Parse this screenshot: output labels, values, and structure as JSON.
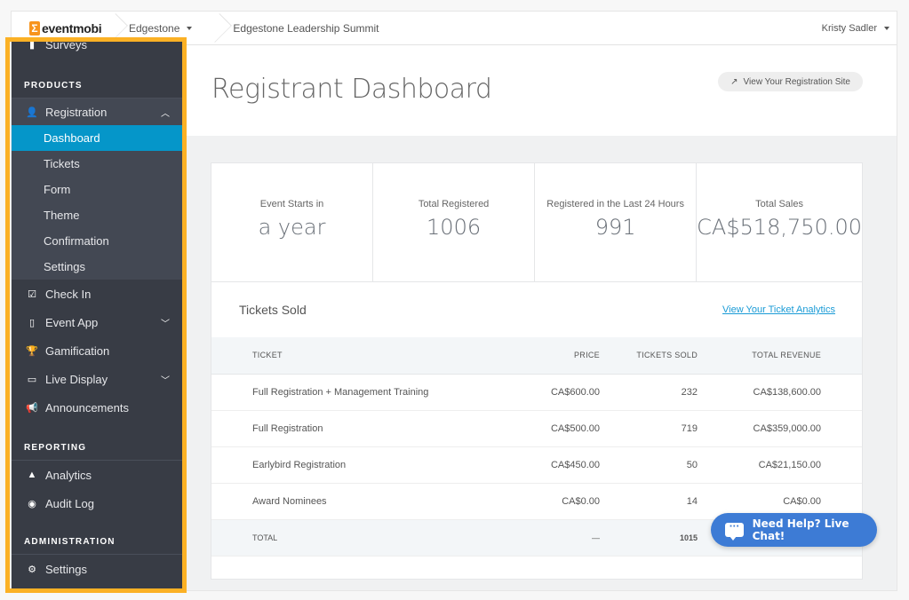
{
  "topbar": {
    "logo_text": "eventmobi",
    "org_crumb": "Edgestone",
    "event_crumb": "Edgestone Leadership Summit",
    "user_name": "Kristy Sadler"
  },
  "sidebar": {
    "top_item": {
      "label": "Surveys",
      "icon": "surveys-icon"
    },
    "sections": [
      {
        "title": "PRODUCTS"
      },
      {
        "title": "REPORTING"
      },
      {
        "title": "ADMINISTRATION"
      }
    ],
    "registration": {
      "label": "Registration",
      "expanded": true,
      "children": [
        "Dashboard",
        "Tickets",
        "Form",
        "Theme",
        "Confirmation",
        "Settings"
      ],
      "active": "Dashboard"
    },
    "products_items": [
      {
        "label": "Check In",
        "icon": "check-in-icon"
      },
      {
        "label": "Event App",
        "icon": "event-app-icon",
        "has_chevron": true
      },
      {
        "label": "Gamification",
        "icon": "trophy-icon"
      },
      {
        "label": "Live Display",
        "icon": "live-display-icon",
        "has_chevron": true
      },
      {
        "label": "Announcements",
        "icon": "megaphone-icon"
      }
    ],
    "reporting_items": [
      {
        "label": "Analytics",
        "icon": "analytics-icon"
      },
      {
        "label": "Audit Log",
        "icon": "audit-log-icon"
      }
    ],
    "administration_items": [
      {
        "label": "Settings",
        "icon": "gear-icon"
      }
    ]
  },
  "main": {
    "page_title": "Registrant Dashboard",
    "view_site_button": "View Your Registration Site",
    "stats": [
      {
        "label": "Event Starts in",
        "value": "a year"
      },
      {
        "label": "Total Registered",
        "value": "1006"
      },
      {
        "label": "Registered in the Last 24 Hours",
        "value": "991"
      },
      {
        "label": "Total Sales",
        "value": "CA$518,750.00"
      }
    ],
    "tickets": {
      "title": "Tickets Sold",
      "analytics_link": "View Your Ticket Analytics",
      "columns": [
        "TICKET",
        "PRICE",
        "TICKETS SOLD",
        "TOTAL REVENUE"
      ],
      "rows": [
        {
          "ticket": "Full Registration + Management Training",
          "price": "CA$600.00",
          "sold": "232",
          "revenue": "CA$138,600.00"
        },
        {
          "ticket": "Full Registration",
          "price": "CA$500.00",
          "sold": "719",
          "revenue": "CA$359,000.00"
        },
        {
          "ticket": "Earlybird Registration",
          "price": "CA$450.00",
          "sold": "50",
          "revenue": "CA$21,150.00"
        },
        {
          "ticket": "Award Nominees",
          "price": "CA$0.00",
          "sold": "14",
          "revenue": "CA$0.00"
        }
      ],
      "total": {
        "label": "TOTAL",
        "price": "—",
        "sold": "1015",
        "revenue": ""
      }
    }
  },
  "chat_button": "Need Help? Live Chat!",
  "colors": {
    "sidebar_bg": "#383c45",
    "active_item": "#0596c9",
    "highlight": "#fbb125",
    "chat": "#3d7bd5",
    "link": "#1a9bd6"
  }
}
